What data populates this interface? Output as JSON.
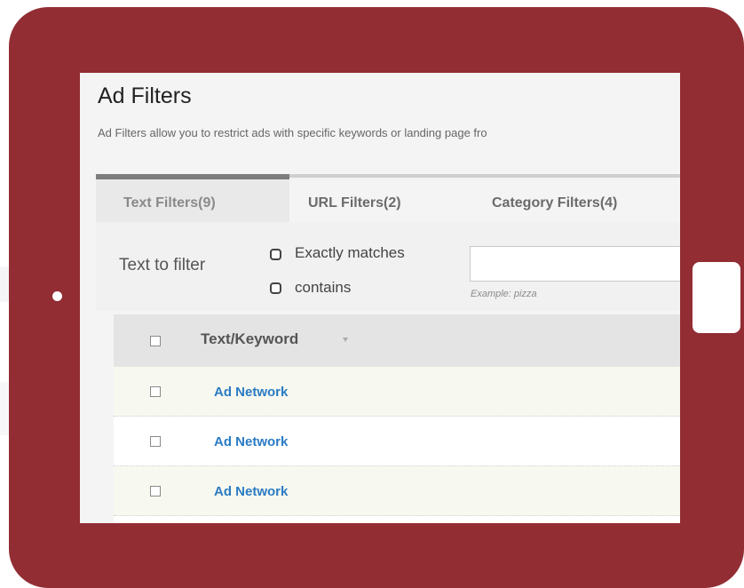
{
  "page": {
    "title": "Ad Filters",
    "description": "Ad Filters allow you to restrict ads with specific keywords or landing page fro"
  },
  "tabs": [
    {
      "label": "Text Filters(9)",
      "active": true
    },
    {
      "label": "URL Filters(2)",
      "active": false
    },
    {
      "label": "Category Filters(4)",
      "active": false
    }
  ],
  "filter": {
    "label": "Text to filter",
    "options": [
      {
        "label": "Exactly matches",
        "selected": false
      },
      {
        "label": "contains",
        "selected": false
      }
    ],
    "input_value": "",
    "example_hint": "Example: pizza"
  },
  "table": {
    "header": "Text/Keyword",
    "rows": [
      {
        "text": "Ad Network"
      },
      {
        "text": "Ad Network"
      },
      {
        "text": "Ad Network"
      }
    ]
  },
  "colors": {
    "frame": "#922d34",
    "link": "#2a7bc4"
  }
}
